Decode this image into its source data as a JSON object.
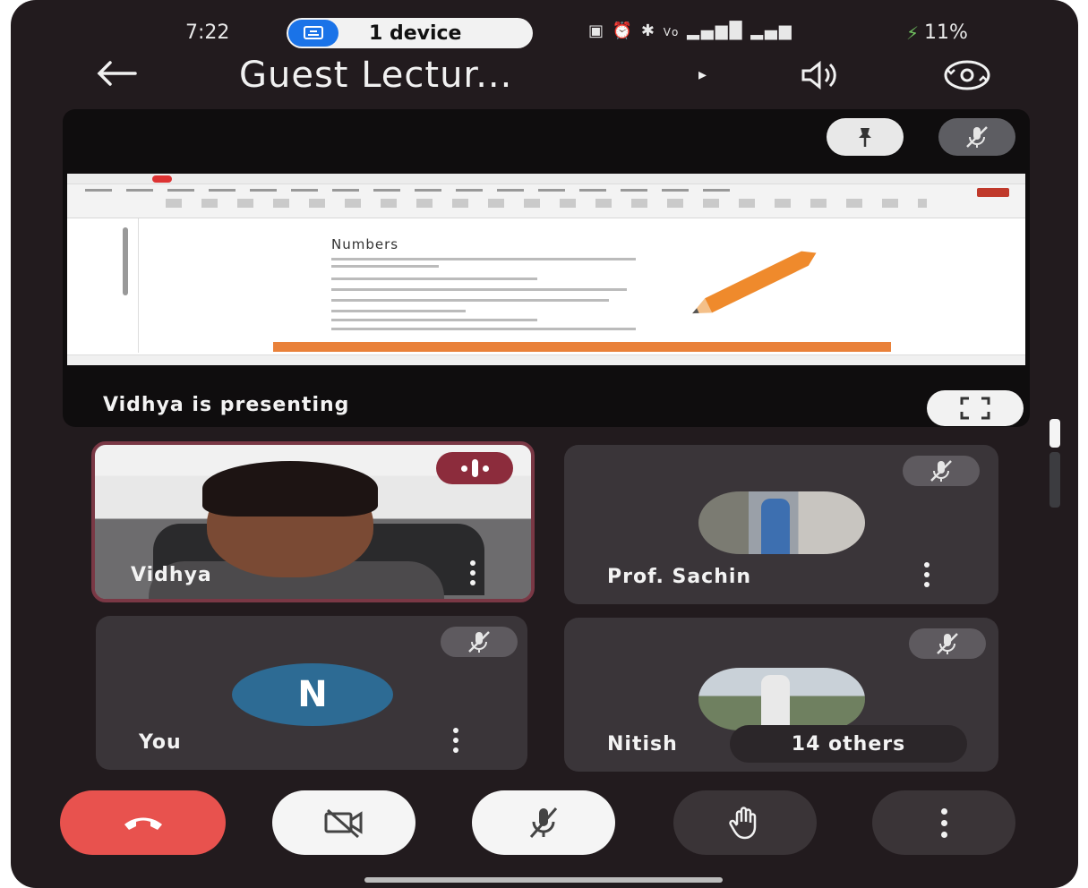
{
  "status_bar": {
    "time": "7:22",
    "cast_label": "1 device",
    "battery": "11%",
    "icons": [
      "nfc-icon",
      "alarm-icon",
      "bluetooth-icon",
      "volte-icon",
      "signal-icon",
      "signal-icon",
      "charging-icon"
    ]
  },
  "header": {
    "title": "Guest Lectur...",
    "title_arrow": "▸"
  },
  "presentation": {
    "presenting_label": "Vidhya is presenting",
    "slide_heading": "Numbers"
  },
  "participants": [
    {
      "name": "Vidhya",
      "state": "speaking",
      "video": "on"
    },
    {
      "name": "Prof. Sachin",
      "state": "muted",
      "video": "off"
    },
    {
      "name": "You",
      "state": "muted",
      "video": "off",
      "avatar_letter": "N"
    },
    {
      "name": "Nitish",
      "state": "muted",
      "video": "off",
      "others_label": "14 others"
    }
  ],
  "colors": {
    "background": "#221b1e",
    "tile": "#3a3539",
    "end_call": "#e8524e",
    "speaking": "#8c2c3c",
    "avatar_you": "#2d6b94",
    "accent_blue": "#1a73e8"
  }
}
